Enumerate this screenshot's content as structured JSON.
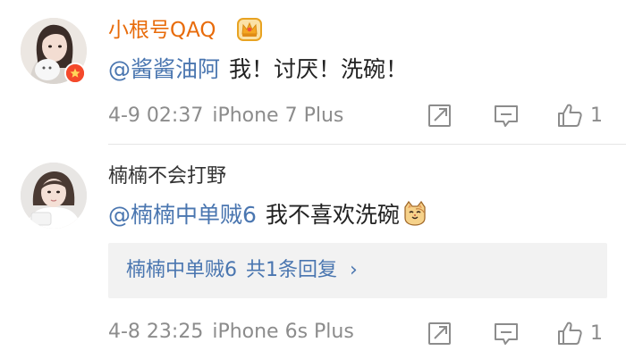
{
  "comments": [
    {
      "username": "小根号QAQ",
      "mention": "@酱酱油阿",
      "message": "我！讨厌！洗碗！",
      "time": "4-9 02:37",
      "device": "iPhone 7 Plus",
      "likes": "1"
    },
    {
      "username": "楠楠不会打野",
      "mention": "@楠楠中单贼6",
      "message": "我不喜欢洗碗",
      "reply_author": "楠楠中单贼6",
      "reply_count": "共1条回复",
      "reply_chevron": "›",
      "time": "4-8 23:25",
      "device": "iPhone 6s Plus",
      "likes": "1"
    }
  ],
  "colors": {
    "vip_name": "#e86b0a",
    "link": "#4a76b0",
    "meta_gray": "#8c8c8c",
    "badge_red": "#f4492b"
  },
  "icons": [
    "crown-icon",
    "verified-badge-icon",
    "share-icon",
    "comment-icon",
    "like-icon",
    "cat-emoji"
  ]
}
